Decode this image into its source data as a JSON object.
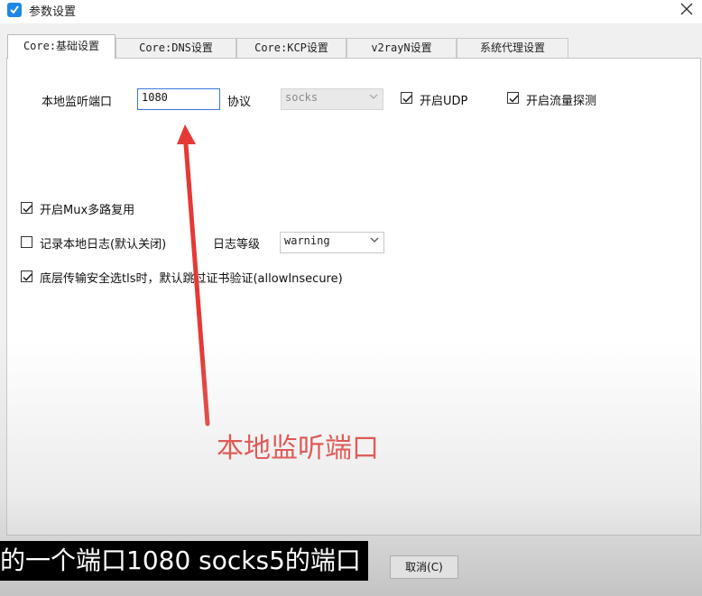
{
  "window": {
    "title": "参数设置",
    "app_icon": "v2rayn-check-icon",
    "close_icon": "close-icon"
  },
  "tabs": [
    {
      "label": "Core:基础设置",
      "active": true
    },
    {
      "label": "Core:DNS设置",
      "active": false
    },
    {
      "label": "Core:KCP设置",
      "active": false
    },
    {
      "label": "v2rayN设置",
      "active": false
    },
    {
      "label": "系统代理设置",
      "active": false
    }
  ],
  "settings": {
    "local_port_label": "本地监听端口",
    "local_port_value": "1080",
    "protocol_label": "协议",
    "protocol_value": "socks",
    "enable_udp_label": "开启UDP",
    "enable_udp_checked": true,
    "enable_sniffing_label": "开启流量探测",
    "enable_sniffing_checked": true,
    "enable_mux_label": "开启Mux多路复用",
    "enable_mux_checked": true,
    "log_label": "记录本地日志(默认关闭)",
    "log_checked": false,
    "log_level_label": "日志等级",
    "log_level_value": "warning",
    "allow_insecure_label": "底层传输安全选tls时，默认跳过证书验证(allowInsecure)",
    "allow_insecure_checked": true
  },
  "annotation": {
    "text": "本地监听端口",
    "color": "#e53935"
  },
  "footer": {
    "cancel_label": "取消(C)"
  },
  "subtitle": {
    "text": "的一个端口1080 socks5的端口"
  }
}
